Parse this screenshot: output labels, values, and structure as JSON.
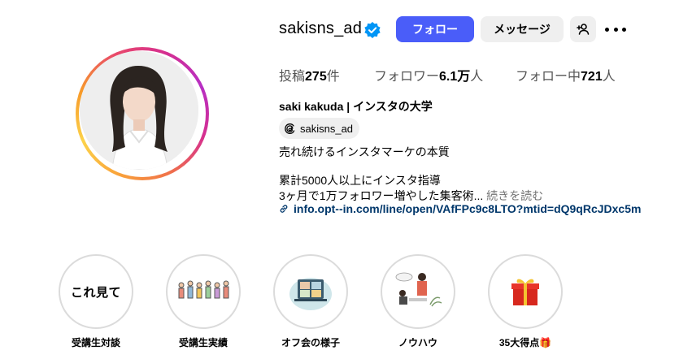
{
  "profile": {
    "username": "sakisns_ad",
    "follow_label": "フォロー",
    "message_label": "メッセージ",
    "full_name": "saki kakuda | インスタの大学",
    "threads_handle": "sakisns_ad"
  },
  "stats": {
    "posts_label": "投稿",
    "posts_value": "275",
    "posts_unit": "件",
    "followers_label": "フォロワー",
    "followers_value": "6.1万",
    "followers_unit": "人",
    "following_label": "フォロー中",
    "following_value": "721",
    "following_unit": "人"
  },
  "bio": {
    "line1": "売れ続けるインスタマーケの本質",
    "line2": "累計5000人以上にインスタ指導",
    "line3": "3ヶ月で1万フォロワー増やした集客術...",
    "more": "続きを読む",
    "link": "info.opt--in.com/line/open/VAfFPc9c8LTO?mtid=dQ9qRcJDxc5m"
  },
  "highlights": [
    {
      "label": "受講生対談",
      "cover_text": "これ見て",
      "icon": "text-cover"
    },
    {
      "label": "受講生実績",
      "icon": "people-illustration"
    },
    {
      "label": "オフ会の様子",
      "icon": "video-call-illustration"
    },
    {
      "label": "ノウハウ",
      "icon": "study-illustration"
    },
    {
      "label": "35大得点🎁",
      "icon": "gift-icon"
    }
  ],
  "colors": {
    "accent": "#4a5df9",
    "link": "#00376b",
    "secondary_text": "#737373",
    "button_bg": "#efefef",
    "verified": "#0095f6"
  }
}
